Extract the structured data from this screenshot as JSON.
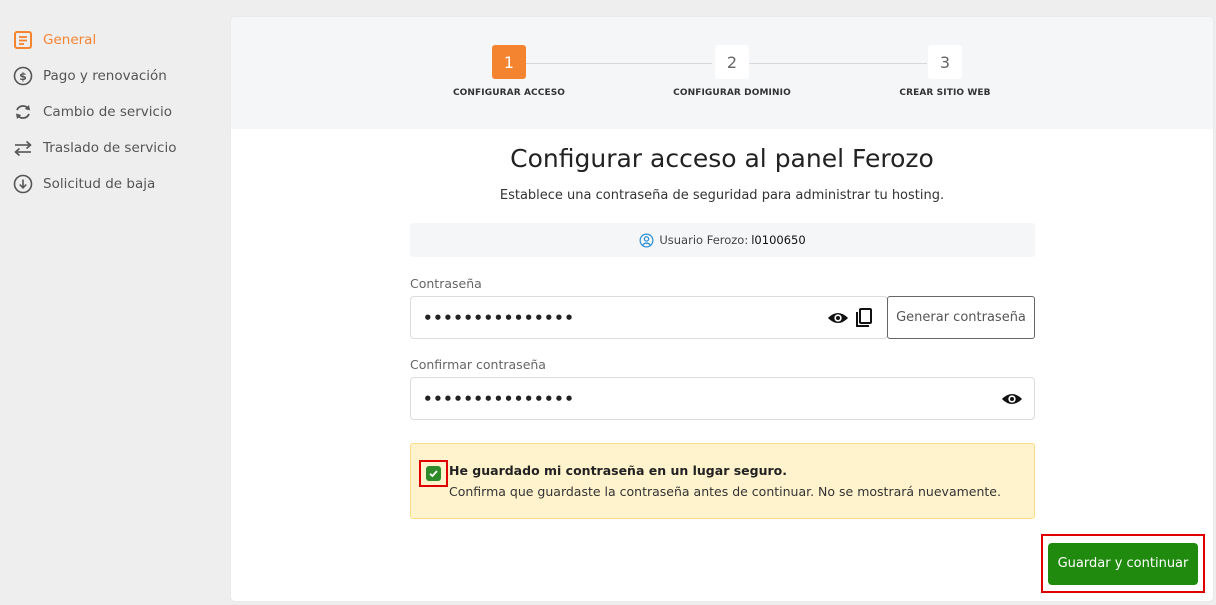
{
  "sidebar": {
    "items": [
      {
        "label": "General",
        "icon": "document-icon",
        "active": true
      },
      {
        "label": "Pago y renovación",
        "icon": "dollar-icon"
      },
      {
        "label": "Cambio de servicio",
        "icon": "refresh-icon"
      },
      {
        "label": "Traslado de servicio",
        "icon": "transfer-icon"
      },
      {
        "label": "Solicitud de baja",
        "icon": "download-circle-icon"
      }
    ]
  },
  "stepper": {
    "steps": [
      {
        "number": "1",
        "label": "CONFIGURAR ACCESO",
        "active": true
      },
      {
        "number": "2",
        "label": "CONFIGURAR DOMINIO"
      },
      {
        "number": "3",
        "label": "CREAR SITIO WEB"
      }
    ]
  },
  "content": {
    "title": "Configurar acceso al panel Ferozo",
    "subtitle": "Establece una contraseña de seguridad para administrar tu hosting.",
    "user_label": "Usuario Ferozo:",
    "user_value": "l0100650"
  },
  "form": {
    "password_label": "Contraseña",
    "password_value": "•••••••••••••••",
    "confirm_label": "Confirmar contraseña",
    "confirm_value": "•••••••••••••••",
    "generate_label": "Generar contraseña"
  },
  "notice": {
    "checked": true,
    "title": "He guardado mi contraseña en un lugar seguro.",
    "text": "Confirma que guardaste la contraseña antes de continuar. No se mostrará nuevamente."
  },
  "actions": {
    "save_label": "Guardar y continuar"
  },
  "colors": {
    "accent": "#f58431",
    "primary_button": "#1f8a0e",
    "checkbox": "#2f8a2a",
    "notice_bg": "#fff3cd",
    "highlight": "#e00000"
  }
}
